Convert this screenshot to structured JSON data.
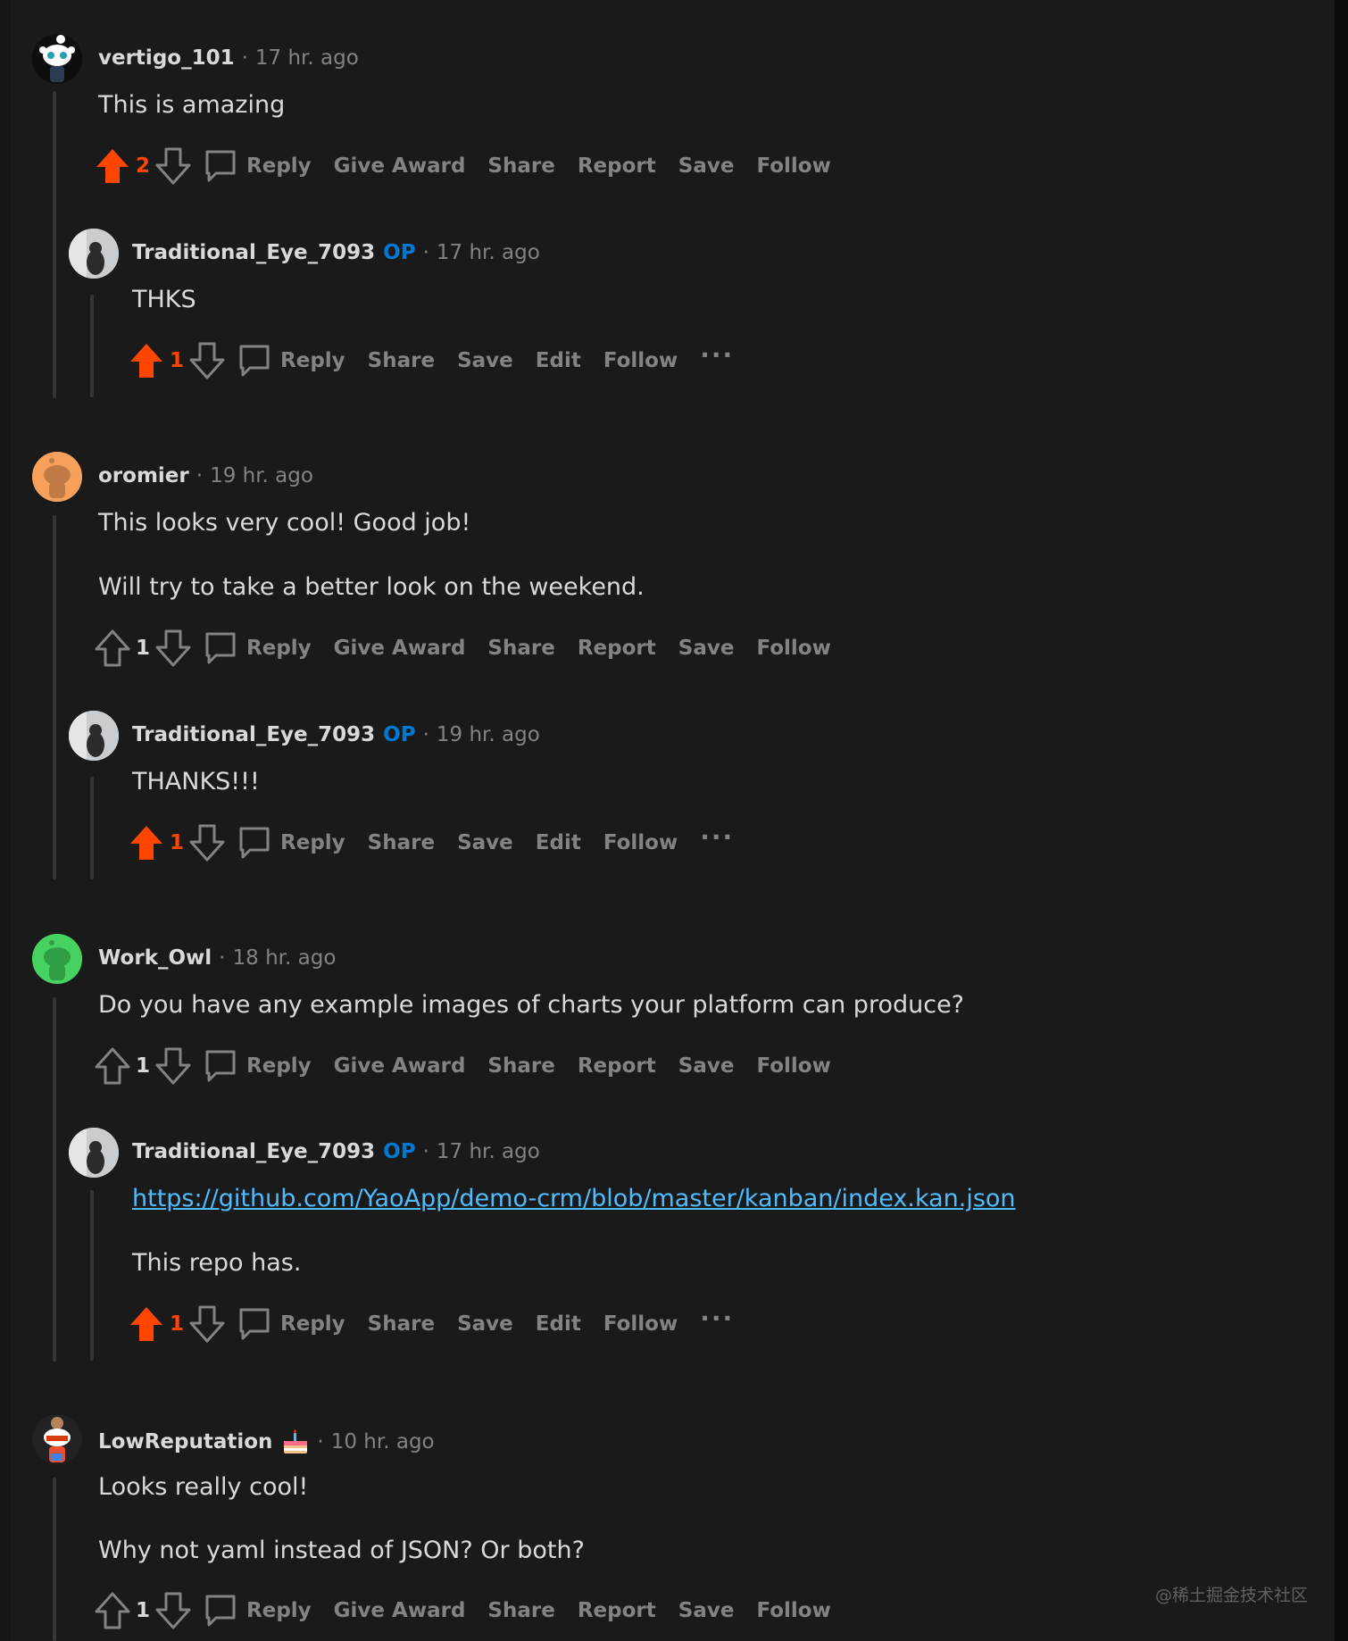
{
  "comments": [
    {
      "author": "vertigo_101",
      "time": "17 hr. ago",
      "lines": [
        "This is amazing"
      ],
      "score": "2",
      "actions": [
        "Reply",
        "Give Award",
        "Share",
        "Report",
        "Save",
        "Follow"
      ]
    },
    {
      "author": "Traditional_Eye_7093",
      "badge": "OP",
      "time": "17 hr. ago",
      "lines": [
        "THKS"
      ],
      "score": "1",
      "actions": [
        "Reply",
        "Share",
        "Save",
        "Edit",
        "Follow"
      ],
      "more": "···"
    },
    {
      "author": "oromier",
      "time": "19 hr. ago",
      "lines": [
        "This looks very cool! Good job!",
        "Will try to take a better look on the weekend."
      ],
      "score": "1",
      "actions": [
        "Reply",
        "Give Award",
        "Share",
        "Report",
        "Save",
        "Follow"
      ]
    },
    {
      "author": "Traditional_Eye_7093",
      "badge": "OP",
      "time": "19 hr. ago",
      "lines": [
        "THANKS!!!"
      ],
      "score": "1",
      "actions": [
        "Reply",
        "Share",
        "Save",
        "Edit",
        "Follow"
      ],
      "more": "···"
    },
    {
      "author": "Work_Owl",
      "time": "18 hr. ago",
      "lines": [
        "Do you have any example images of charts your platform can produce?"
      ],
      "score": "1",
      "actions": [
        "Reply",
        "Give Award",
        "Share",
        "Report",
        "Save",
        "Follow"
      ]
    },
    {
      "author": "Traditional_Eye_7093",
      "badge": "OP",
      "time": "17 hr. ago",
      "link": "https://github.com/YaoApp/demo-crm/blob/master/kanban/index.kan.json",
      "lines": [
        "This repo has."
      ],
      "score": "1",
      "actions": [
        "Reply",
        "Share",
        "Save",
        "Edit",
        "Follow"
      ],
      "more": "···"
    },
    {
      "author": "LowReputation",
      "time": "10 hr. ago",
      "lines": [
        "Looks really cool!",
        "Why not yaml instead of JSON? Or both?"
      ],
      "score": "1",
      "actions": [
        "Reply",
        "Give Award",
        "Share",
        "Report",
        "Save",
        "Follow"
      ]
    }
  ],
  "watermark": "@稀土掘金技术社区",
  "colors": {
    "background": "#1a1a1b",
    "upvote": "#ff4500",
    "op": "#0079d3",
    "link": "#4fbcff",
    "muted": "#818384"
  }
}
